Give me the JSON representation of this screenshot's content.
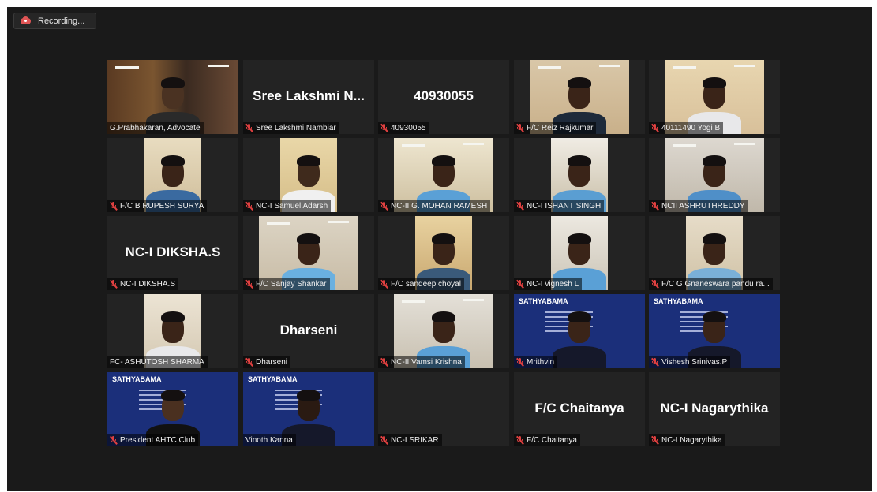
{
  "recording": {
    "label": "Recording...",
    "icon": "cloud-record-icon",
    "color": "#e05555"
  },
  "active_speaker_color": "#c8d84a",
  "tiles": [
    {
      "label": "G.Prabhakaran, Advocate",
      "muted": false,
      "video": true,
      "big_name": ""
    },
    {
      "label": "Sree Lakshmi Nambiar",
      "muted": true,
      "video": false,
      "big_name": "Sree Lakshmi N..."
    },
    {
      "label": "40930055",
      "muted": true,
      "video": false,
      "big_name": "40930055"
    },
    {
      "label": "F/C Reiz Rajkumar",
      "muted": true,
      "video": true,
      "big_name": ""
    },
    {
      "label": "40111490 Yogi B",
      "muted": true,
      "video": true,
      "big_name": ""
    },
    {
      "label": "F/C B RUPESH SURYA",
      "muted": true,
      "video": true,
      "big_name": ""
    },
    {
      "label": "NC-I Samuel Adarsh",
      "muted": true,
      "video": true,
      "big_name": ""
    },
    {
      "label": "NC-II G. MOHAN RAMESH",
      "muted": true,
      "video": true,
      "big_name": ""
    },
    {
      "label": "NC-I ISHANT SINGH",
      "muted": true,
      "video": true,
      "big_name": ""
    },
    {
      "label": "NCII ASHRUTHREDDY",
      "muted": true,
      "video": true,
      "big_name": ""
    },
    {
      "label": "NC-I DIKSHA.S",
      "muted": true,
      "video": false,
      "big_name": "NC-I DIKSHA.S"
    },
    {
      "label": "F/C Sanjay Shankar",
      "muted": true,
      "video": true,
      "big_name": ""
    },
    {
      "label": "F/C sandeep choyal",
      "muted": true,
      "video": true,
      "big_name": ""
    },
    {
      "label": "NC-I vignesh L",
      "muted": true,
      "video": true,
      "big_name": ""
    },
    {
      "label": "F/C G Gnaneswara pandu ra...",
      "muted": true,
      "video": true,
      "big_name": ""
    },
    {
      "label": "FC- ASHUTOSH SHARMA",
      "muted": false,
      "video": true,
      "big_name": ""
    },
    {
      "label": "Dharseni",
      "muted": true,
      "video": false,
      "big_name": "Dharseni"
    },
    {
      "label": "NC-II Vamsi Krishna",
      "muted": true,
      "video": true,
      "big_name": ""
    },
    {
      "label": "Mrithvin",
      "muted": true,
      "video": true,
      "big_name": ""
    },
    {
      "label": "Vishesh Srinivas.P",
      "muted": true,
      "video": true,
      "big_name": ""
    },
    {
      "label": "President AHTC Club",
      "muted": true,
      "video": true,
      "big_name": ""
    },
    {
      "label": "Vinoth Kanna",
      "muted": false,
      "video": true,
      "big_name": ""
    },
    {
      "label": "NC-I SRIKAR",
      "muted": true,
      "video": false,
      "big_name": ""
    },
    {
      "label": "F/C Chaitanya",
      "muted": true,
      "video": false,
      "big_name": "F/C Chaitanya"
    },
    {
      "label": "NC-I Nagarythika",
      "muted": true,
      "video": false,
      "big_name": "NC-I Nagarythika"
    }
  ],
  "banner_text": "SATHYABAMA"
}
